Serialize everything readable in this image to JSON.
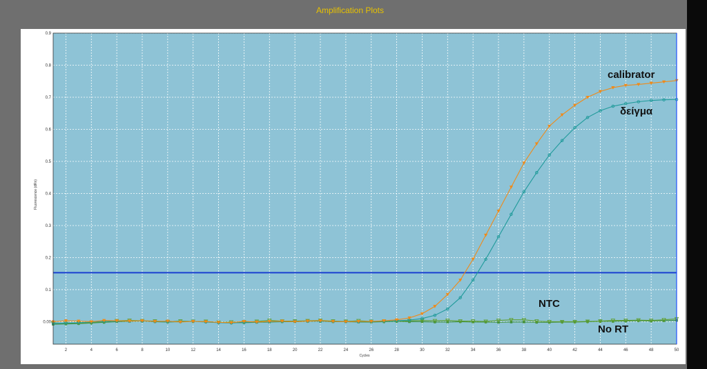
{
  "window": {
    "title": "Amplification Plots"
  },
  "colors": {
    "plot_background": "#8ec3d6",
    "grid": "#ffffff",
    "threshold": "#1a3fd0",
    "calibrator": "#f08a18",
    "sample": "#1f9a9a",
    "ntc": "#5f9f2f",
    "no_rt": "#3f8f3f",
    "title": "#e8c200",
    "frame": "#6f6f6f"
  },
  "chart_data": {
    "type": "line",
    "title": "Amplification Plots",
    "xlabel": "Cycles",
    "ylabel": "Fluorescence (dRn)",
    "xlim": [
      1,
      50
    ],
    "ylim": [
      -0.07,
      0.9
    ],
    "x_ticks": [
      2,
      4,
      6,
      8,
      10,
      12,
      14,
      16,
      18,
      20,
      22,
      24,
      26,
      28,
      30,
      32,
      34,
      36,
      38,
      40,
      42,
      44,
      46,
      48,
      50
    ],
    "y_ticks": [
      "0.00",
      "0.1",
      "0.2",
      "0.3",
      "0.4",
      "0.5",
      "0.6",
      "0.7",
      "0.8",
      "0.9"
    ],
    "y_tick_values": [
      0,
      0.1,
      0.2,
      0.3,
      0.4,
      0.5,
      0.6,
      0.7,
      0.8,
      0.9
    ],
    "grid": true,
    "threshold": 0.153,
    "x": [
      1,
      2,
      3,
      4,
      5,
      6,
      7,
      8,
      9,
      10,
      11,
      12,
      13,
      14,
      15,
      16,
      17,
      18,
      19,
      20,
      21,
      22,
      23,
      24,
      25,
      26,
      27,
      28,
      29,
      30,
      31,
      32,
      33,
      34,
      35,
      36,
      37,
      38,
      39,
      40,
      41,
      42,
      43,
      44,
      45,
      46,
      47,
      48,
      49,
      50
    ],
    "series": [
      {
        "name": "calibrator",
        "label": "calibrator",
        "values": [
          0.0,
          0.003,
          0.002,
          0.0,
          0.004,
          0.003,
          0.002,
          0.003,
          0.001,
          0.002,
          -0.001,
          0.001,
          0.0,
          -0.002,
          -0.003,
          0.001,
          -0.001,
          0.001,
          0.002,
          0.0,
          0.002,
          0.003,
          0.001,
          0.0,
          0.001,
          0.001,
          0.003,
          0.006,
          0.012,
          0.025,
          0.048,
          0.085,
          0.13,
          0.195,
          0.27,
          0.345,
          0.42,
          0.495,
          0.555,
          0.61,
          0.645,
          0.675,
          0.7,
          0.718,
          0.73,
          0.737,
          0.74,
          0.744,
          0.748,
          0.752
        ]
      },
      {
        "name": "δείγμα",
        "label": "δείγμα",
        "values": [
          -0.005,
          -0.004,
          -0.003,
          -0.001,
          0.001,
          0.002,
          0.002,
          0.002,
          0.001,
          0.0,
          0.0,
          0.001,
          -0.001,
          -0.003,
          -0.004,
          -0.002,
          -0.001,
          0.0,
          0.001,
          0.001,
          0.002,
          0.001,
          0.001,
          0.0,
          0.0,
          0.001,
          0.002,
          0.003,
          0.005,
          0.01,
          0.02,
          0.04,
          0.075,
          0.13,
          0.195,
          0.265,
          0.335,
          0.405,
          0.465,
          0.52,
          0.565,
          0.605,
          0.637,
          0.658,
          0.672,
          0.68,
          0.686,
          0.69,
          0.692,
          0.693
        ]
      },
      {
        "name": "NTC",
        "label": "NTC",
        "values": [
          -0.004,
          -0.005,
          -0.004,
          -0.003,
          0.0,
          0.003,
          0.004,
          0.003,
          0.002,
          0.0,
          0.002,
          0.001,
          0.001,
          -0.002,
          -0.001,
          -0.001,
          0.001,
          0.004,
          0.002,
          0.002,
          0.003,
          0.004,
          0.002,
          0.001,
          0.003,
          0.001,
          0.001,
          0.002,
          0.003,
          0.004,
          0.003,
          0.004,
          0.002,
          0.002,
          0.001,
          0.004,
          0.006,
          0.006,
          0.002,
          0.0,
          0.0,
          0.0,
          0.001,
          0.002,
          0.004,
          0.004,
          0.005,
          0.004,
          0.006,
          0.009
        ]
      },
      {
        "name": "No RT",
        "label": "No RT",
        "values": [
          -0.008,
          -0.007,
          -0.006,
          -0.004,
          -0.002,
          0.0,
          0.001,
          0.002,
          0.0,
          -0.001,
          0.0,
          0.001,
          0.0,
          -0.002,
          -0.003,
          -0.003,
          -0.002,
          -0.001,
          0.0,
          0.0,
          0.001,
          0.001,
          0.0,
          0.0,
          -0.001,
          -0.001,
          0.0,
          0.001,
          0.0,
          0.0,
          -0.001,
          -0.001,
          0.0,
          -0.001,
          -0.001,
          -0.002,
          -0.001,
          -0.001,
          -0.002,
          -0.002,
          -0.001,
          -0.001,
          0.0,
          0.001,
          0.001,
          0.002,
          0.003,
          0.002,
          0.003,
          0.004
        ]
      }
    ]
  }
}
